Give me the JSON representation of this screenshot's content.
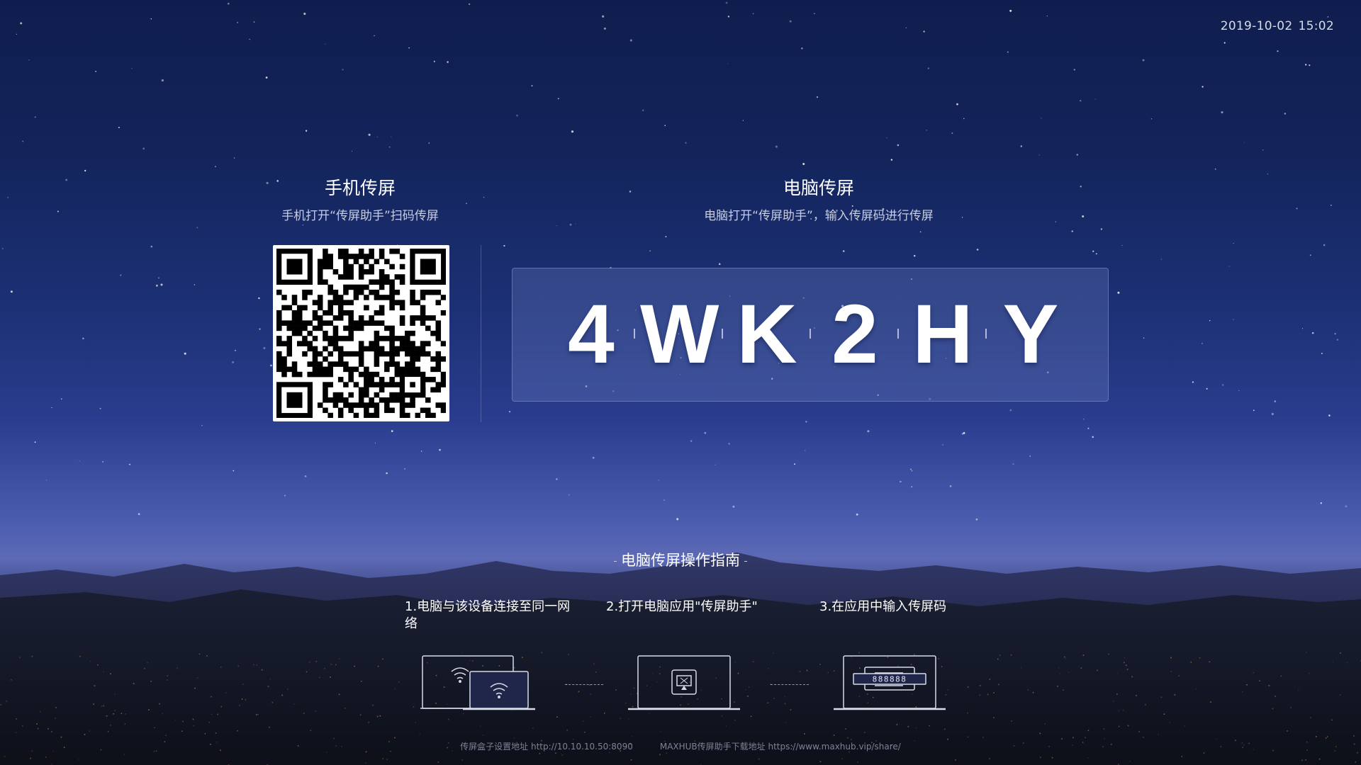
{
  "status": {
    "date": "2019-10-02",
    "time": "15:02"
  },
  "phone_cast": {
    "title": "手机传屏",
    "subtitle": "手机打开“传屏助手”扫码传屏"
  },
  "pc_cast": {
    "title": "电脑传屏",
    "subtitle": "电脑打开“传屏助手”，输入传屏码进行传屏",
    "code": [
      "4",
      "W",
      "K",
      "2",
      "H",
      "Y"
    ]
  },
  "guide": {
    "title": "电脑传屏操作指南",
    "steps": [
      "1.电脑与该设备连接至同一网络",
      "2.打开电脑应用\"传屏助手\"",
      "3.在应用中输入传屏码"
    ],
    "code_preview": "888888"
  },
  "footer": {
    "setup_address": "传屏盒子设置地址 http://10.10.10.50:8090",
    "download_address": "MAXHUB传屏助手下载地址 https://www.maxhub.vip/share/"
  }
}
